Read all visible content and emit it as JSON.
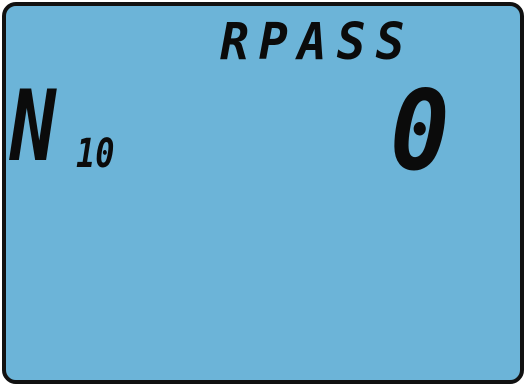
{
  "display": {
    "title": "RPASS",
    "menu_letter": "N",
    "menu_number": "10",
    "value": "0"
  },
  "colors": {
    "screen_background": "#6cb4d8",
    "segment_color": "#0b0b0b",
    "bezel": "#111111"
  }
}
